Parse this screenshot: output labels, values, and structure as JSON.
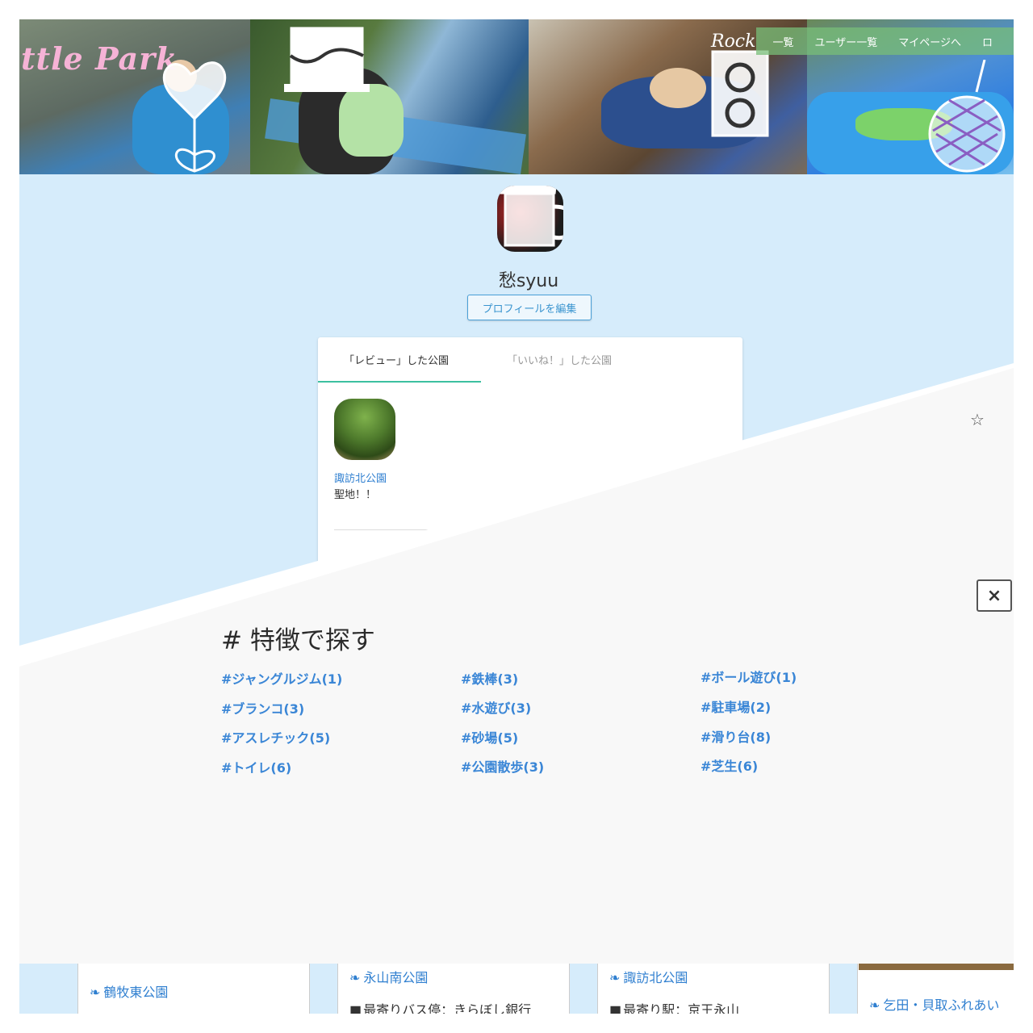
{
  "hero": {
    "logo_text": "ttle Park"
  },
  "nav": {
    "items": [
      "一覧",
      "ユーザー一覧",
      "マイページへ",
      "ロ"
    ]
  },
  "profile": {
    "username": "愁syuu",
    "edit_button": "プロフィールを編集",
    "tabs": [
      "「レビュー」した公園",
      "「いいね！」した公園"
    ],
    "review": {
      "park_name": "諏訪北公園",
      "comment": "聖地！！"
    }
  },
  "tags": {
    "title": "# 特徴で探す",
    "columns": [
      [
        "#ジャングルジム(1)",
        "#ブランコ(3)",
        "#アスレチック(5)",
        "#トイレ(6)"
      ],
      [
        "#鉄棒(3)",
        "#水遊び(3)",
        "#砂場(5)",
        "#公園散歩(3)"
      ],
      [
        "#ボール遊び(1)",
        "#駐車場(2)",
        "#滑り台(8)",
        "#芝生(6)"
      ]
    ]
  },
  "close_button": "×",
  "park_cards": [
    {
      "name": "鶴牧東公園",
      "info": ""
    },
    {
      "name": "永山南公園",
      "info": "最寄りバス停：きらぼし銀行"
    },
    {
      "name": "諏訪北公園",
      "info": "最寄り駅：京王永山"
    },
    {
      "name": "乞田・貝取ふれあい",
      "info": ""
    }
  ],
  "icons": [
    "leaf-icon",
    "bus-icon",
    "star-icon",
    "close-icon"
  ],
  "colors": {
    "page_bg": "#d6ecfb",
    "link": "#3a86d6",
    "tab_accent": "#3cc0a0",
    "nav_bg": "#78be78"
  }
}
